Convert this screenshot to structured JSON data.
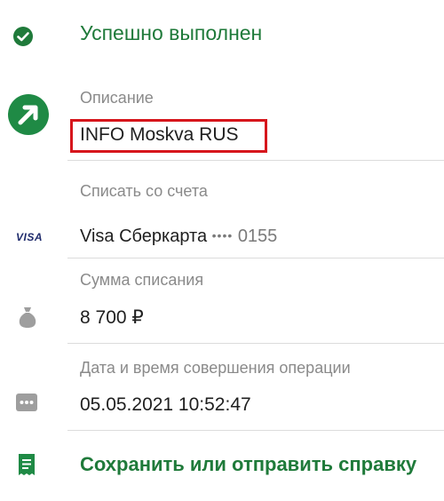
{
  "status": {
    "text": "Успешно выполнен",
    "icon": "check-circle-icon"
  },
  "description": {
    "label": "Описание",
    "value": "INFO Moskva RUS",
    "icon": "arrow-up-right-circle-icon"
  },
  "account": {
    "label": "Списать со счета",
    "card_logo": "VISA",
    "card_name": "Visa Сберкарта",
    "card_mask": "••••",
    "card_last4": "0155"
  },
  "amount": {
    "label": "Сумма списания",
    "value": "8 700 ₽",
    "icon": "money-bag-icon"
  },
  "datetime": {
    "label": "Дата и время совершения операции",
    "value": "05.05.2021 10:52:47",
    "icon": "ellipsis-box-icon"
  },
  "action": {
    "label": "Сохранить или отправить справку",
    "icon": "receipt-icon"
  },
  "colors": {
    "accent": "#1f7a3a",
    "highlight": "#d6161c",
    "icon_grey": "#9e9e9e"
  }
}
